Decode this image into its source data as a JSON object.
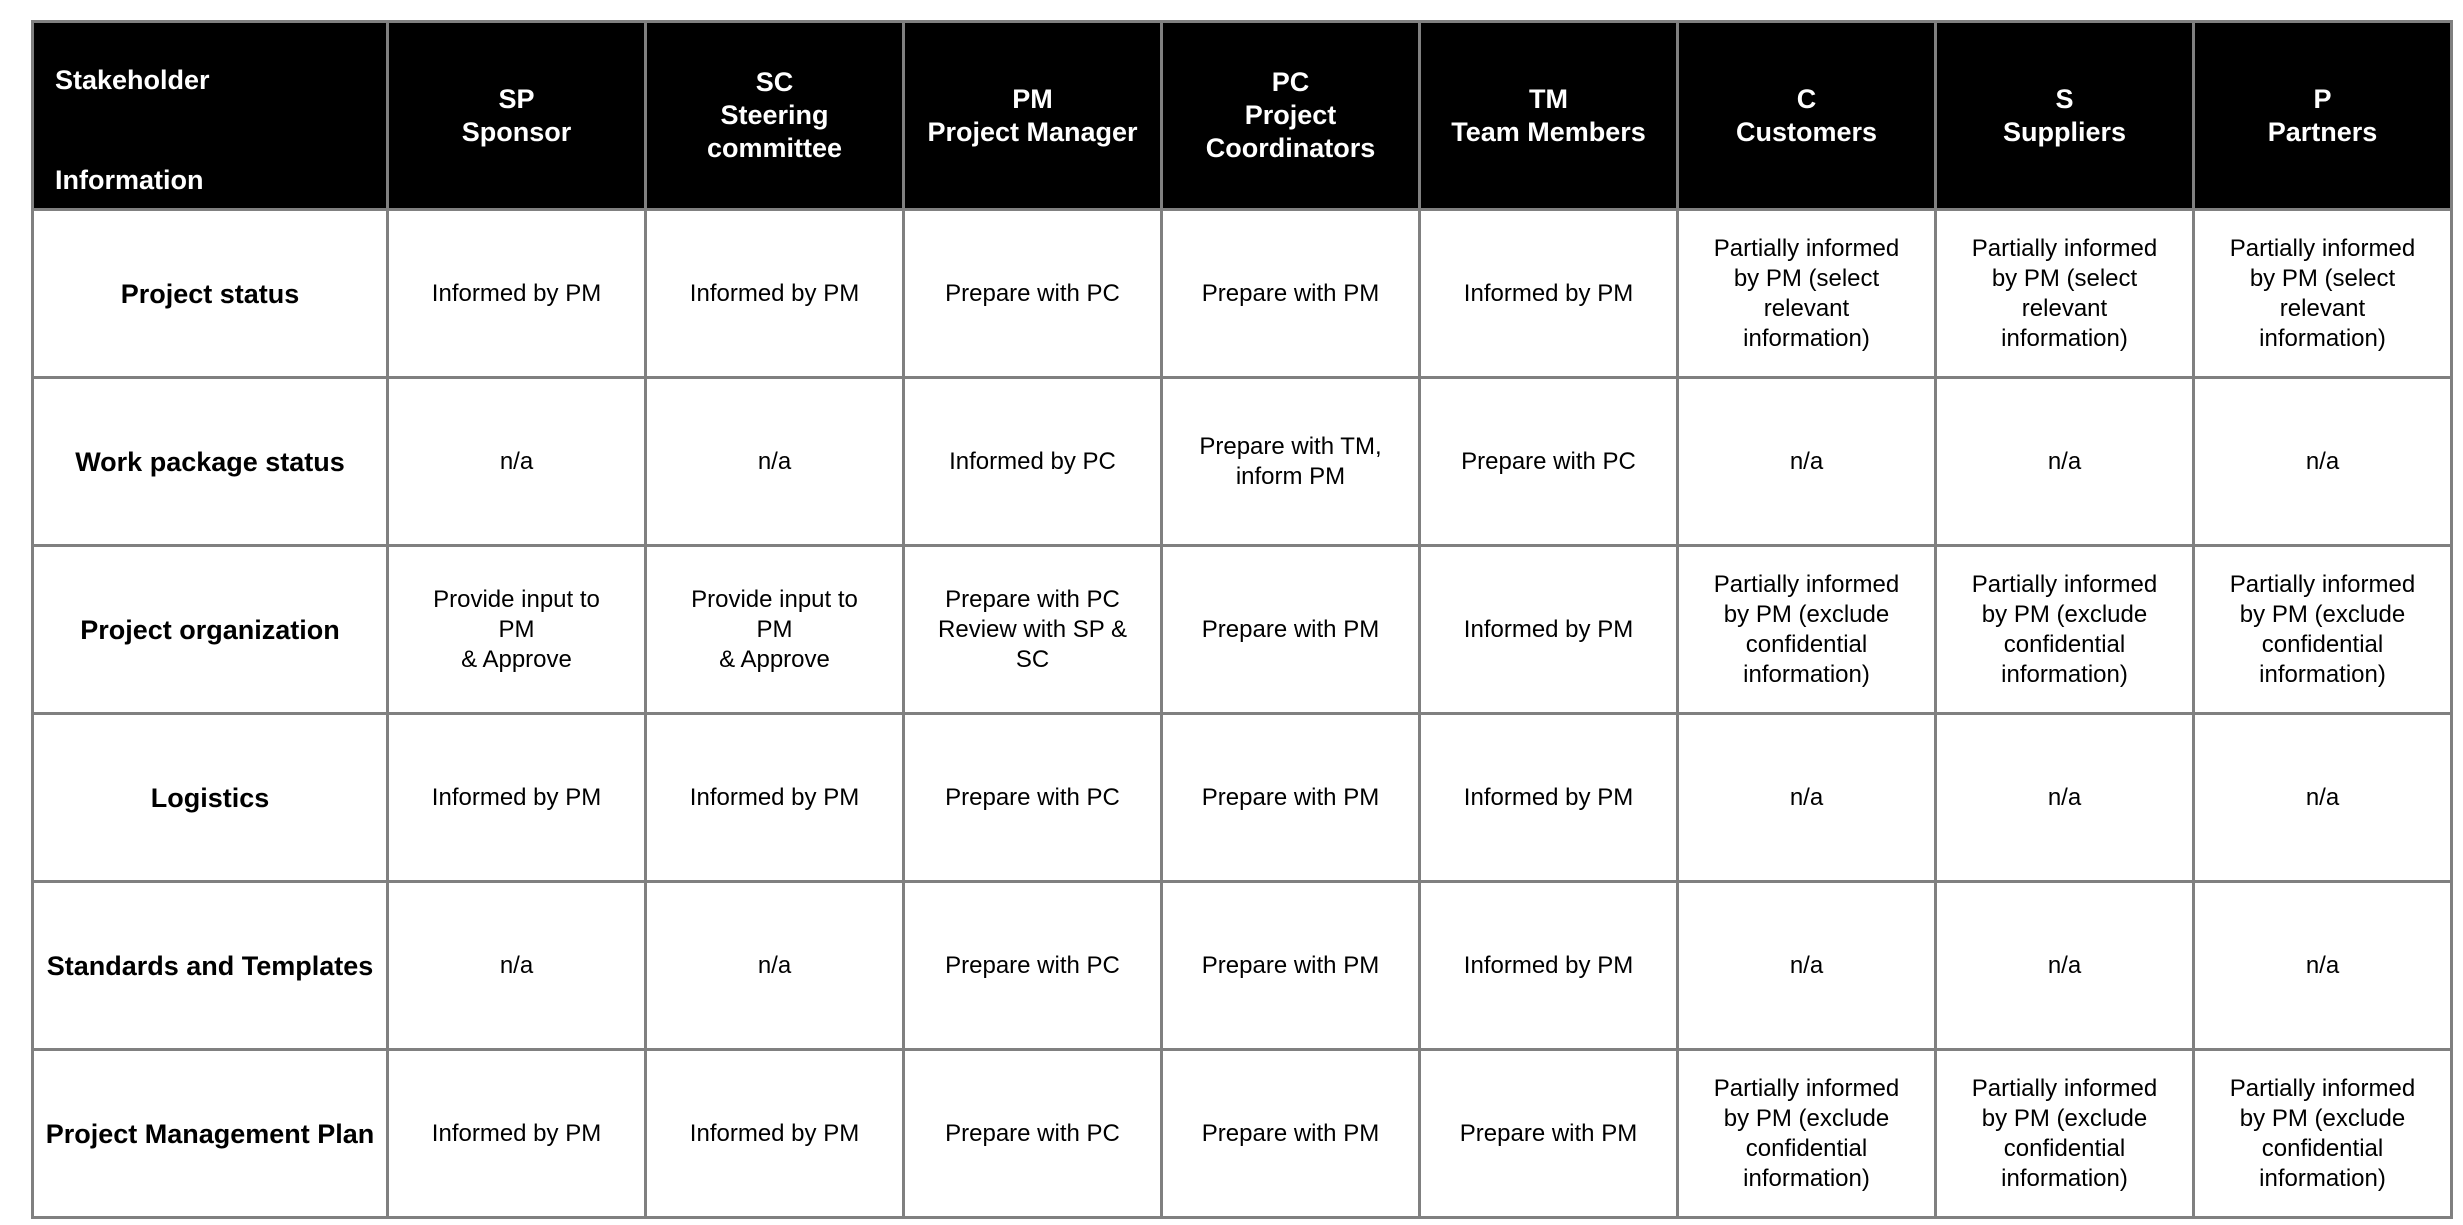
{
  "table": {
    "corner": {
      "top": "Stakeholder",
      "bottom": "Information"
    },
    "columns": [
      {
        "code": "SP",
        "name": "Sponsor",
        "label": "SP\nSponsor"
      },
      {
        "code": "SC",
        "name": "Steering committee",
        "label": "SC\nSteering\ncommittee"
      },
      {
        "code": "PM",
        "name": "Project Manager",
        "label": "PM\nProject Manager"
      },
      {
        "code": "PC",
        "name": "Project Coordinators",
        "label": "PC\nProject\nCoordinators"
      },
      {
        "code": "TM",
        "name": "Team Members",
        "label": "TM\nTeam Members"
      },
      {
        "code": "C",
        "name": "Customers",
        "label": "C\nCustomers"
      },
      {
        "code": "S",
        "name": "Suppliers",
        "label": "S\nSuppliers"
      },
      {
        "code": "P",
        "name": "Partners",
        "label": "P\nPartners"
      }
    ],
    "rows": [
      {
        "label": "Project status",
        "cells": [
          "Informed by PM",
          "Informed by PM",
          "Prepare with PC",
          "Prepare with PM",
          "Informed by PM",
          "Partially informed\nby PM (select\nrelevant\ninformation)",
          "Partially informed\nby PM (select\nrelevant\ninformation)",
          "Partially informed\nby PM (select\nrelevant\ninformation)"
        ]
      },
      {
        "label": "Work package status",
        "cells": [
          "n/a",
          "n/a",
          "Informed by PC",
          "Prepare with TM,\ninform PM",
          "Prepare with PC",
          "n/a",
          "n/a",
          "n/a"
        ]
      },
      {
        "label": "Project organization",
        "cells": [
          "Provide input to\nPM\n& Approve",
          "Provide input to\nPM\n& Approve",
          "Prepare with PC\nReview with SP &\nSC",
          "Prepare with PM",
          "Informed by PM",
          "Partially informed\nby PM (exclude\nconfidential\ninformation)",
          "Partially informed\nby PM (exclude\nconfidential\ninformation)",
          "Partially informed\nby PM (exclude\nconfidential\ninformation)"
        ]
      },
      {
        "label": "Logistics",
        "cells": [
          "Informed by PM",
          "Informed by PM",
          "Prepare with PC",
          "Prepare with PM",
          "Informed by PM",
          "n/a",
          "n/a",
          "n/a"
        ]
      },
      {
        "label": "Standards and Templates",
        "cells": [
          "n/a",
          "n/a",
          "Prepare with PC",
          "Prepare with PM",
          "Informed by PM",
          "n/a",
          "n/a",
          "n/a"
        ]
      },
      {
        "label": "Project Management Plan",
        "cells": [
          "Informed by PM",
          "Informed by PM",
          "Prepare with PC",
          "Prepare with PM",
          "Prepare with PM",
          "Partially informed\nby PM (exclude\nconfidential\ninformation)",
          "Partially informed\nby PM (exclude\nconfidential\ninformation)",
          "Partially informed\nby PM (exclude\nconfidential\ninformation)"
        ]
      }
    ]
  },
  "colors": {
    "header_bg": "#000000",
    "header_text": "#ffffff",
    "grid": "#808080",
    "body_bg": "#ffffff",
    "body_text": "#000000"
  }
}
